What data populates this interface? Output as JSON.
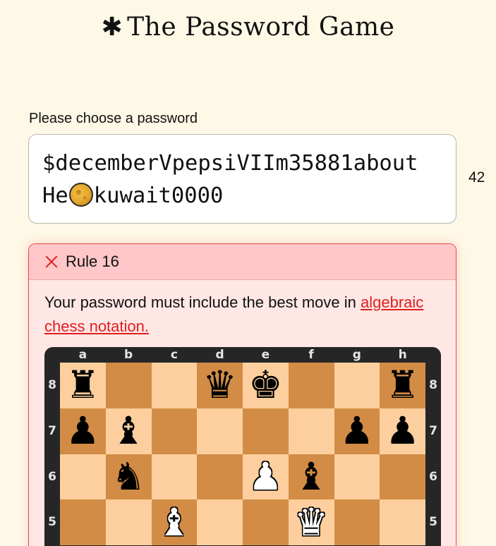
{
  "header": {
    "title": "The Password Game",
    "icon": "asterisk-icon"
  },
  "password": {
    "label": "Please choose a password",
    "value_part1": "$decemberVpepsiVIIm35881about He",
    "emoji": "moon-icon",
    "value_part2": "kuwait0000",
    "length": "42"
  },
  "rule": {
    "title": "Rule 16",
    "status": "failing",
    "description": "Your password must include the best move in ",
    "link_text": "algebraic chess notation.",
    "colors": {
      "fail_border": "#e05050",
      "fail_header": "#ffc7c7",
      "fail_body": "#ffe7e5",
      "link": "#e01f1f"
    }
  },
  "chess": {
    "files": [
      "a",
      "b",
      "c",
      "d",
      "e",
      "f",
      "g",
      "h"
    ],
    "ranks": [
      "8",
      "7",
      "6",
      "5"
    ],
    "board": [
      [
        "♜",
        "",
        "",
        "♛",
        "♚",
        "",
        "",
        "♜"
      ],
      [
        "♟",
        "♝",
        "",
        "",
        "",
        "",
        "♟",
        "♟"
      ],
      [
        "",
        "♞",
        "",
        "",
        "♙",
        "♝",
        "",
        ""
      ],
      [
        "",
        "",
        "♗",
        "",
        "",
        "♕",
        "",
        ""
      ]
    ],
    "colors": {
      "light": "#fdcf9e",
      "dark": "#d28c45",
      "frame": "#262626"
    }
  }
}
